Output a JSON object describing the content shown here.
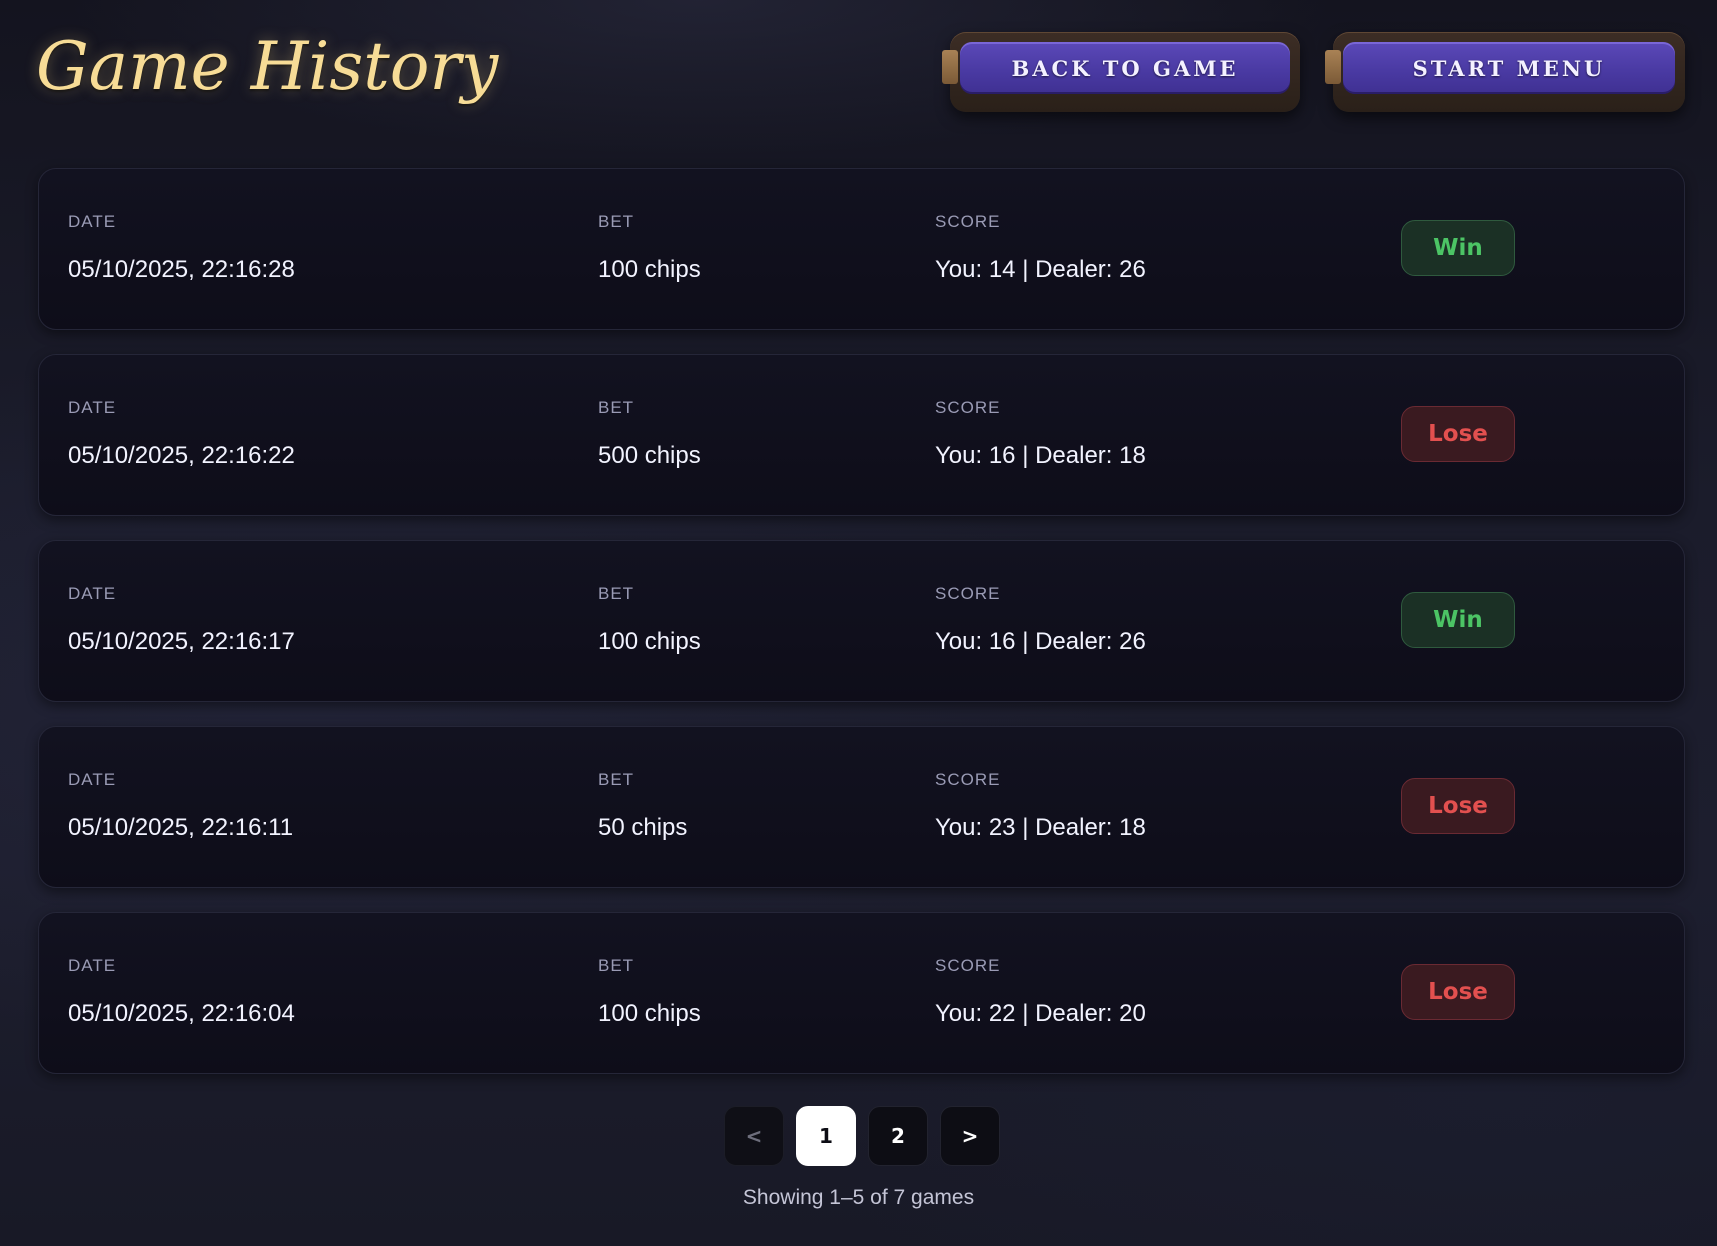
{
  "header": {
    "title": "Game History",
    "back_label": "BACK TO GAME",
    "start_label": "START MENU"
  },
  "columns": {
    "date": "DATE",
    "bet": "BET",
    "score": "SCORE"
  },
  "games": [
    {
      "date": "05/10/2025, 22:16:28",
      "bet": "100 chips",
      "score": "You: 14 | Dealer: 26",
      "result": "Win"
    },
    {
      "date": "05/10/2025, 22:16:22",
      "bet": "500 chips",
      "score": "You: 16 | Dealer: 18",
      "result": "Lose"
    },
    {
      "date": "05/10/2025, 22:16:17",
      "bet": "100 chips",
      "score": "You: 16 | Dealer: 26",
      "result": "Win"
    },
    {
      "date": "05/10/2025, 22:16:11",
      "bet": "50 chips",
      "score": "You: 23 | Dealer: 18",
      "result": "Lose"
    },
    {
      "date": "05/10/2025, 22:16:04",
      "bet": "100 chips",
      "score": "You: 22 | Dealer: 20",
      "result": "Lose"
    }
  ],
  "pagination": {
    "prev": "<",
    "pages": [
      "1",
      "2"
    ],
    "current_page": "1",
    "next": ">",
    "summary": "Showing 1–5 of 7 games"
  },
  "colors": {
    "title_gold": "#f7dc96",
    "button_purple": "#4a3aa3",
    "win_green": "#4cc465",
    "lose_red": "#e2504f",
    "background": "#1b1c2b"
  }
}
